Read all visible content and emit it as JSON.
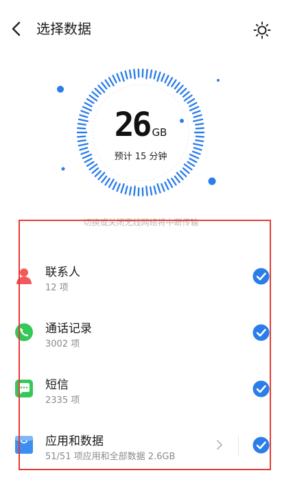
{
  "header": {
    "title": "选择数据",
    "back_icon": "chevron-left-icon",
    "action_icon": "brightness-icon"
  },
  "summary": {
    "size_value": "26",
    "size_unit": "GB",
    "eta": "预计 15 分钟",
    "hint": "切换或关闭无线网络将中断传输"
  },
  "items": [
    {
      "title": "联系人",
      "subtitle": "12 项",
      "icon": "contact-icon",
      "icon_color": "#f25a5a",
      "checked": true
    },
    {
      "title": "通话记录",
      "subtitle": "3002 项",
      "icon": "phone-icon",
      "icon_color": "#34c759",
      "checked": true
    },
    {
      "title": "短信",
      "subtitle": "2335 项",
      "icon": "message-icon",
      "icon_color": "#34c759",
      "checked": true
    },
    {
      "title": "应用和数据",
      "subtitle": "51/51 项应用和全部数据  2.6GB",
      "icon": "app-bag-icon",
      "icon_color": "#3a8ff0",
      "checked": true,
      "has_detail": true
    }
  ],
  "colors": {
    "accent": "#2b7de9",
    "highlight_border": "#e53935"
  }
}
